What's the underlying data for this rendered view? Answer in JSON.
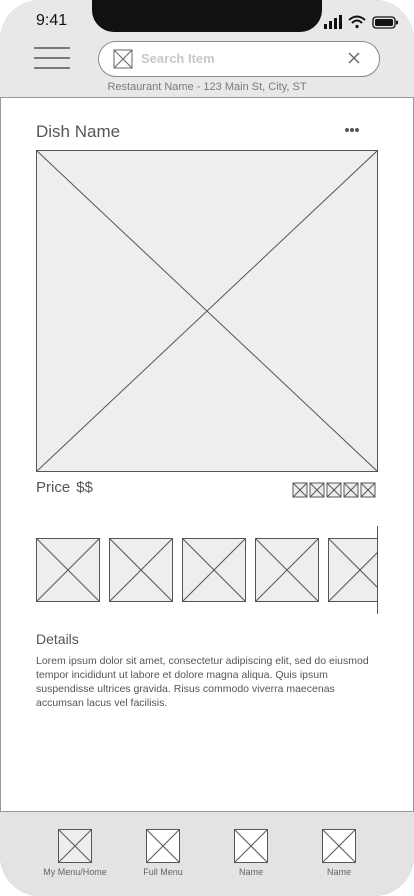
{
  "status_bar": {
    "time": "9:41"
  },
  "search": {
    "placeholder": "Search Item"
  },
  "restaurant_info": "Restaurant Name - 123 Main St, City, ST",
  "dish": {
    "name": "Dish Name",
    "price_label": "Price",
    "price_value": "$$",
    "rating_stars": 5
  },
  "thumbnails_count": 5,
  "details": {
    "label": "Details",
    "text": "Lorem ipsum dolor sit amet, consectetur adipiscing elit, sed do eiusmod tempor incididunt ut labore et dolore magna aliqua. Quis ipsum suspendisse ultrices gravida. Risus commodo viverra maecenas accumsan lacus vel facilisis."
  },
  "tabs": [
    {
      "label": "My Menu/Home"
    },
    {
      "label": "Full Menu"
    },
    {
      "label": "Name"
    },
    {
      "label": "Name"
    }
  ],
  "colors": {
    "header_bg": "#e8e8e8",
    "tabbar_bg": "#e3e3e3",
    "placeholder_fill": "#eeeeee",
    "stroke": "#555555"
  }
}
